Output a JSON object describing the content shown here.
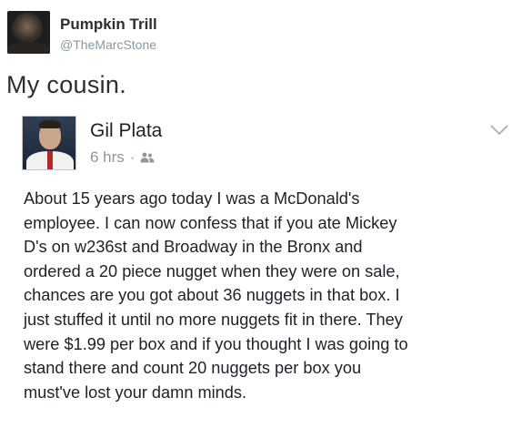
{
  "tweet": {
    "author": {
      "display_name": "Pumpkin Trill",
      "handle": "@TheMarcStone"
    },
    "text": "My cousin."
  },
  "facebook_post": {
    "author_name": "Gil Plata",
    "timestamp": "6 hrs",
    "separator": "·",
    "audience_icon": "friends-icon",
    "menu_icon": "chevron-down-icon",
    "body_lines": [
      "About 15 years ago today I was a McDonald's",
      "employee. I can now confess that if you ate Mickey",
      "D's on w236st and Broadway in the Bronx and",
      "ordered a 20 piece nugget when they were on sale,",
      "chances are you got about 36 nuggets in that box. I",
      "just stuffed it until no more nuggets fit in there. They",
      "were $1.99 per box and if you thought I was going to",
      "stand there and count 20 nuggets per box you",
      "must've lost your damn minds."
    ]
  }
}
